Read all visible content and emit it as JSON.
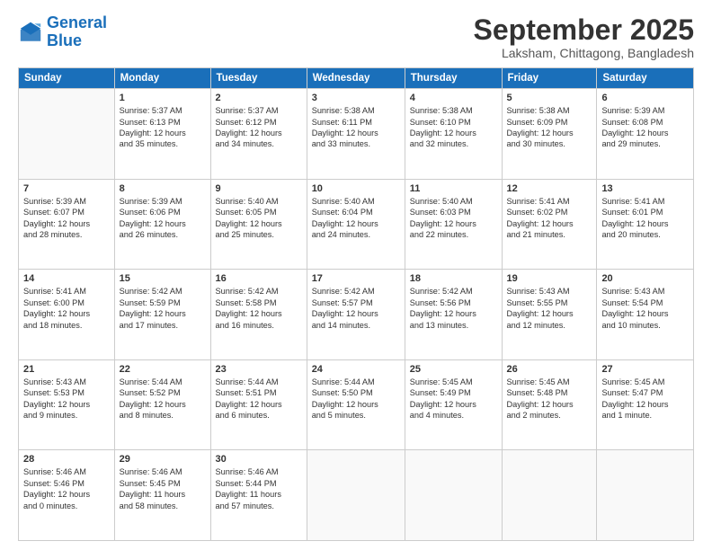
{
  "logo": {
    "line1": "General",
    "line2": "Blue"
  },
  "title": "September 2025",
  "location": "Laksham, Chittagong, Bangladesh",
  "headers": [
    "Sunday",
    "Monday",
    "Tuesday",
    "Wednesday",
    "Thursday",
    "Friday",
    "Saturday"
  ],
  "weeks": [
    [
      {
        "day": "",
        "lines": []
      },
      {
        "day": "1",
        "lines": [
          "Sunrise: 5:37 AM",
          "Sunset: 6:13 PM",
          "Daylight: 12 hours",
          "and 35 minutes."
        ]
      },
      {
        "day": "2",
        "lines": [
          "Sunrise: 5:37 AM",
          "Sunset: 6:12 PM",
          "Daylight: 12 hours",
          "and 34 minutes."
        ]
      },
      {
        "day": "3",
        "lines": [
          "Sunrise: 5:38 AM",
          "Sunset: 6:11 PM",
          "Daylight: 12 hours",
          "and 33 minutes."
        ]
      },
      {
        "day": "4",
        "lines": [
          "Sunrise: 5:38 AM",
          "Sunset: 6:10 PM",
          "Daylight: 12 hours",
          "and 32 minutes."
        ]
      },
      {
        "day": "5",
        "lines": [
          "Sunrise: 5:38 AM",
          "Sunset: 6:09 PM",
          "Daylight: 12 hours",
          "and 30 minutes."
        ]
      },
      {
        "day": "6",
        "lines": [
          "Sunrise: 5:39 AM",
          "Sunset: 6:08 PM",
          "Daylight: 12 hours",
          "and 29 minutes."
        ]
      }
    ],
    [
      {
        "day": "7",
        "lines": [
          "Sunrise: 5:39 AM",
          "Sunset: 6:07 PM",
          "Daylight: 12 hours",
          "and 28 minutes."
        ]
      },
      {
        "day": "8",
        "lines": [
          "Sunrise: 5:39 AM",
          "Sunset: 6:06 PM",
          "Daylight: 12 hours",
          "and 26 minutes."
        ]
      },
      {
        "day": "9",
        "lines": [
          "Sunrise: 5:40 AM",
          "Sunset: 6:05 PM",
          "Daylight: 12 hours",
          "and 25 minutes."
        ]
      },
      {
        "day": "10",
        "lines": [
          "Sunrise: 5:40 AM",
          "Sunset: 6:04 PM",
          "Daylight: 12 hours",
          "and 24 minutes."
        ]
      },
      {
        "day": "11",
        "lines": [
          "Sunrise: 5:40 AM",
          "Sunset: 6:03 PM",
          "Daylight: 12 hours",
          "and 22 minutes."
        ]
      },
      {
        "day": "12",
        "lines": [
          "Sunrise: 5:41 AM",
          "Sunset: 6:02 PM",
          "Daylight: 12 hours",
          "and 21 minutes."
        ]
      },
      {
        "day": "13",
        "lines": [
          "Sunrise: 5:41 AM",
          "Sunset: 6:01 PM",
          "Daylight: 12 hours",
          "and 20 minutes."
        ]
      }
    ],
    [
      {
        "day": "14",
        "lines": [
          "Sunrise: 5:41 AM",
          "Sunset: 6:00 PM",
          "Daylight: 12 hours",
          "and 18 minutes."
        ]
      },
      {
        "day": "15",
        "lines": [
          "Sunrise: 5:42 AM",
          "Sunset: 5:59 PM",
          "Daylight: 12 hours",
          "and 17 minutes."
        ]
      },
      {
        "day": "16",
        "lines": [
          "Sunrise: 5:42 AM",
          "Sunset: 5:58 PM",
          "Daylight: 12 hours",
          "and 16 minutes."
        ]
      },
      {
        "day": "17",
        "lines": [
          "Sunrise: 5:42 AM",
          "Sunset: 5:57 PM",
          "Daylight: 12 hours",
          "and 14 minutes."
        ]
      },
      {
        "day": "18",
        "lines": [
          "Sunrise: 5:42 AM",
          "Sunset: 5:56 PM",
          "Daylight: 12 hours",
          "and 13 minutes."
        ]
      },
      {
        "day": "19",
        "lines": [
          "Sunrise: 5:43 AM",
          "Sunset: 5:55 PM",
          "Daylight: 12 hours",
          "and 12 minutes."
        ]
      },
      {
        "day": "20",
        "lines": [
          "Sunrise: 5:43 AM",
          "Sunset: 5:54 PM",
          "Daylight: 12 hours",
          "and 10 minutes."
        ]
      }
    ],
    [
      {
        "day": "21",
        "lines": [
          "Sunrise: 5:43 AM",
          "Sunset: 5:53 PM",
          "Daylight: 12 hours",
          "and 9 minutes."
        ]
      },
      {
        "day": "22",
        "lines": [
          "Sunrise: 5:44 AM",
          "Sunset: 5:52 PM",
          "Daylight: 12 hours",
          "and 8 minutes."
        ]
      },
      {
        "day": "23",
        "lines": [
          "Sunrise: 5:44 AM",
          "Sunset: 5:51 PM",
          "Daylight: 12 hours",
          "and 6 minutes."
        ]
      },
      {
        "day": "24",
        "lines": [
          "Sunrise: 5:44 AM",
          "Sunset: 5:50 PM",
          "Daylight: 12 hours",
          "and 5 minutes."
        ]
      },
      {
        "day": "25",
        "lines": [
          "Sunrise: 5:45 AM",
          "Sunset: 5:49 PM",
          "Daylight: 12 hours",
          "and 4 minutes."
        ]
      },
      {
        "day": "26",
        "lines": [
          "Sunrise: 5:45 AM",
          "Sunset: 5:48 PM",
          "Daylight: 12 hours",
          "and 2 minutes."
        ]
      },
      {
        "day": "27",
        "lines": [
          "Sunrise: 5:45 AM",
          "Sunset: 5:47 PM",
          "Daylight: 12 hours",
          "and 1 minute."
        ]
      }
    ],
    [
      {
        "day": "28",
        "lines": [
          "Sunrise: 5:46 AM",
          "Sunset: 5:46 PM",
          "Daylight: 12 hours",
          "and 0 minutes."
        ]
      },
      {
        "day": "29",
        "lines": [
          "Sunrise: 5:46 AM",
          "Sunset: 5:45 PM",
          "Daylight: 11 hours",
          "and 58 minutes."
        ]
      },
      {
        "day": "30",
        "lines": [
          "Sunrise: 5:46 AM",
          "Sunset: 5:44 PM",
          "Daylight: 11 hours",
          "and 57 minutes."
        ]
      },
      {
        "day": "",
        "lines": []
      },
      {
        "day": "",
        "lines": []
      },
      {
        "day": "",
        "lines": []
      },
      {
        "day": "",
        "lines": []
      }
    ]
  ]
}
